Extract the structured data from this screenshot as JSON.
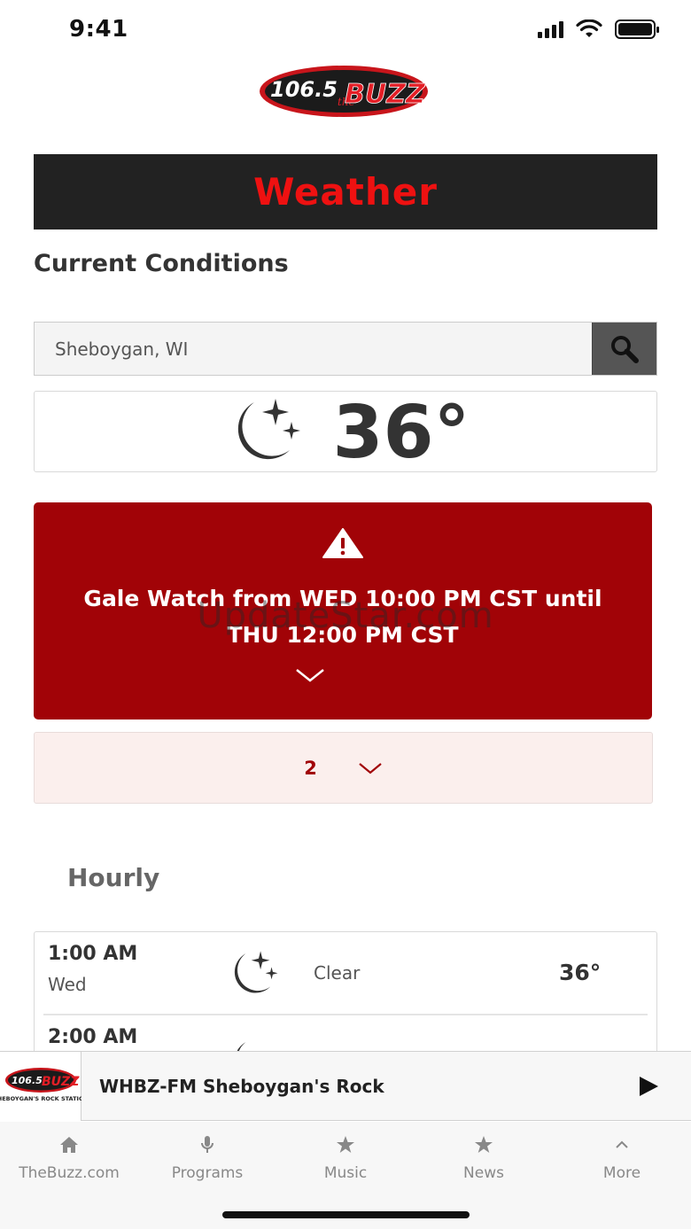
{
  "status_bar": {
    "time": "9:41"
  },
  "logo": {
    "freq": "106.5",
    "the": "the",
    "brand": "BUZZ"
  },
  "header": {
    "title": "Weather"
  },
  "current": {
    "section_title": "Current Conditions",
    "search": {
      "value": "Sheboygan, WI",
      "icon": "search-icon"
    },
    "temperature": "36°",
    "icon": "moon-stars-icon"
  },
  "alert": {
    "icon": "warning-icon",
    "text": "Gale Watch from WED 10:00 PM CST until THU 12:00 PM CST",
    "watermark": "UpdateStar.com",
    "background": "#a10307"
  },
  "more_alerts": {
    "count": "2"
  },
  "hourly": {
    "title": "Hourly",
    "rows": [
      {
        "time": "1:00 AM",
        "day": "Wed",
        "condition": "Clear",
        "temp": "36°",
        "icon": "moon-stars-icon"
      },
      {
        "time": "2:00 AM",
        "day": "",
        "condition": "",
        "temp": "",
        "icon": "moon-icon"
      }
    ]
  },
  "player": {
    "logo_sub": "SHEBOYGAN'S ROCK STATION",
    "station": "WHBZ-FM Sheboygan's Rock",
    "play_icon": "play-icon"
  },
  "tabs": [
    {
      "label": "TheBuzz.com",
      "icon": "home-icon"
    },
    {
      "label": "Programs",
      "icon": "microphone-icon"
    },
    {
      "label": "Music",
      "icon": "star-icon"
    },
    {
      "label": "News",
      "icon": "star-icon"
    },
    {
      "label": "More",
      "icon": "chevron-up-icon"
    }
  ],
  "colors": {
    "brand_red": "#ee1111",
    "alert_red": "#a10307",
    "header_bg": "#222222"
  }
}
